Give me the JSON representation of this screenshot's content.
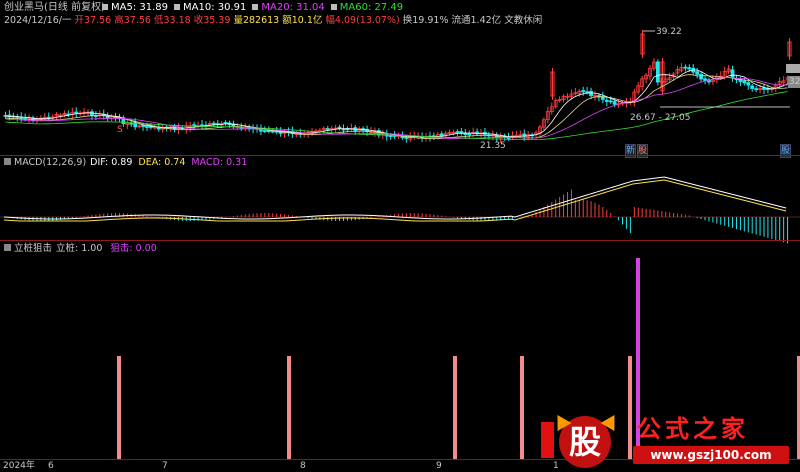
{
  "header": {
    "title": "创业黑马(日线 前复权)",
    "ma": [
      {
        "label": "MA5: 31.89",
        "color": "#ffffff"
      },
      {
        "label": "MA10: 30.91",
        "color": "#ffffff"
      },
      {
        "label": "MA20: 31.04",
        "color": "#e040fb"
      },
      {
        "label": "MA60: 27.49",
        "color": "#33dd33"
      }
    ],
    "quote": {
      "date": "2024/12/16/一",
      "open": "开37.56",
      "high": "高37.56",
      "low": "低33.18",
      "close": "收35.39",
      "volume": "量282613",
      "amount": "额10.1亿",
      "change": "幅4.09(13.07%)",
      "turnover": "换19.91%",
      "float": "流通1.42亿",
      "sector": "文教休闲"
    }
  },
  "price_panel": {
    "label_high": "39.22",
    "label_low": "21.35",
    "label_range": "26.67 - 27.05",
    "label_right": "32.",
    "marker_left": "S",
    "marker_badge1": "新",
    "marker_badge2": "股",
    "marker_right": "股"
  },
  "macd": {
    "name": "MACD(12,26,9)",
    "dif": "DIF: 0.89",
    "dea": "DEA: 0.74",
    "macd": "MACD: 0.31",
    "macd_color": "#e040fb"
  },
  "indicator": {
    "name": "立桩狙击",
    "li": "立桩: 1.00",
    "ju": "狙击: 0.00",
    "ju_color": "#e040fb"
  },
  "bottom_axis": {
    "year": "2024年",
    "months": [
      "6",
      "7",
      "8",
      "9",
      "1"
    ]
  },
  "watermark": {
    "logo": "股",
    "brand": "公式之家",
    "url": "www.gszj100.com"
  },
  "colors": {
    "up": "#ff3d3d",
    "down": "#1ee8ee",
    "ma5": "#ffffff",
    "ma20": "#e040fb",
    "ma60": "#33dd33",
    "bar_pink": "#f08c8c",
    "bar_purple": "#d243e0"
  }
}
